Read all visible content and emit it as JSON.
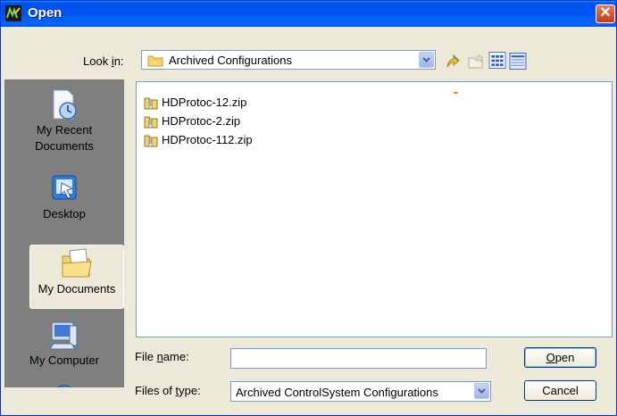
{
  "window": {
    "title": "Open"
  },
  "lookin": {
    "label_pre": "Look ",
    "label_key": "i",
    "label_post": "n:",
    "value": "Archived Configurations"
  },
  "toolbar": {
    "icons": [
      "up-one-level-icon",
      "new-folder-icon",
      "list-view-icon",
      "details-view-icon"
    ]
  },
  "places": [
    {
      "label_line1": "My Recent",
      "label_line2": "Documents",
      "icon": "recent-documents-icon"
    },
    {
      "label": "Desktop",
      "icon": "desktop-icon"
    },
    {
      "label": "My Documents",
      "icon": "my-documents-icon",
      "selected": true
    },
    {
      "label": "My Computer",
      "icon": "my-computer-icon"
    },
    {
      "icon": "network-places-icon"
    }
  ],
  "files": [
    {
      "name": "HDProtoc-12.zip",
      "icon": "zip-icon"
    },
    {
      "name": "HDProtoc-2.zip",
      "icon": "zip-icon"
    },
    {
      "name": "HDProtoc-112.zip",
      "icon": "zip-icon"
    }
  ],
  "filename": {
    "label_pre": "File ",
    "label_key": "n",
    "label_post": "ame:",
    "value": ""
  },
  "filetype": {
    "label_pre": "Files of ",
    "label_key": "t",
    "label_post": "ype:",
    "value": "Archived ControlSystem Configurations"
  },
  "buttons": {
    "open_key": "O",
    "open_rest": "pen",
    "cancel": "Cancel"
  },
  "colors": {
    "titlebar": "#0053ee",
    "dialog_bg": "#ece9d8",
    "places_bg": "#7f7f7f",
    "close": "#c53a17"
  }
}
